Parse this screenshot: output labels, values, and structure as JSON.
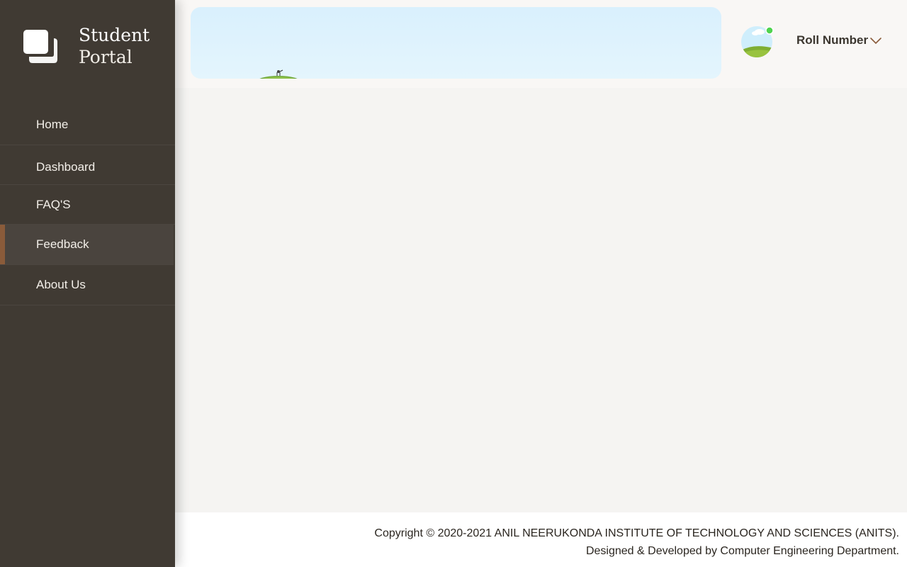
{
  "brand": {
    "line1": "Student",
    "line2": "Portal",
    "icon": "stacked-squares-logo-icon"
  },
  "sidebar": {
    "items": [
      {
        "label": "Home",
        "active": false
      },
      {
        "label": "Dashboard",
        "active": false
      },
      {
        "label": "FAQ'S",
        "active": false
      },
      {
        "label": "Feedback",
        "active": true
      },
      {
        "label": "About Us",
        "active": false
      }
    ]
  },
  "header": {
    "user_label": "Roll Number",
    "status_color": "#4fd34f",
    "dropdown_icon": "chevron-down-icon"
  },
  "footer": {
    "copyright": "Copyright © 2020-2021 ANIL NEERUKONDA INSTITUTE OF TECHNOLOGY AND SCIENCES (ANITS).",
    "credit": "Designed & Developed by Computer Engineering Department."
  },
  "colors": {
    "sidebar_bg": "#403a33",
    "active_accent": "#8a5b3a",
    "page_bg": "#f5f4f2"
  }
}
